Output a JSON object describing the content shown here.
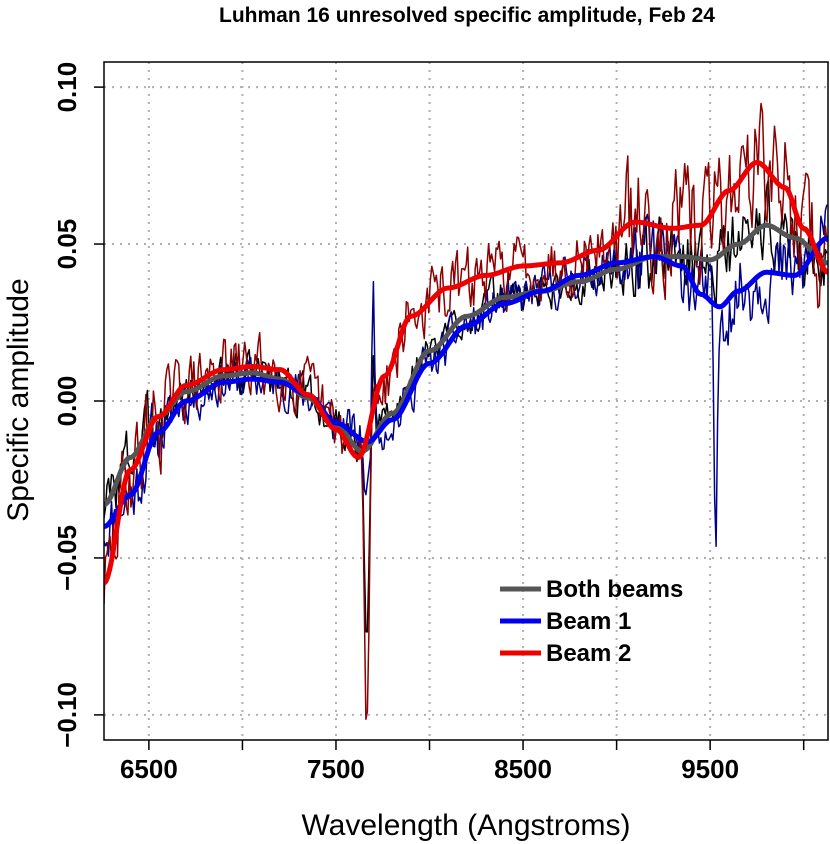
{
  "chart_data": {
    "type": "line",
    "title": "Luhman 16 unresolved specific amplitude, Feb 24",
    "xlabel": "Wavelength (Angstroms)",
    "ylabel": "Specific amplitude",
    "xlim": [
      6260,
      10130
    ],
    "ylim": [
      -0.108,
      0.108
    ],
    "x_ticks": [
      6500,
      7000,
      7500,
      8000,
      8500,
      9000,
      9500,
      10000
    ],
    "x_tick_labels": [
      "6500",
      "",
      "7500",
      "",
      "8500",
      "",
      "9500",
      ""
    ],
    "y_ticks": [
      -0.1,
      -0.05,
      0.0,
      0.05,
      0.1
    ],
    "y_tick_labels": [
      "−0.10",
      "−0.05",
      "0.00",
      "0.05",
      "0.10"
    ],
    "grid": true,
    "legend_position": "bottom-right",
    "smooth_series": [
      {
        "name": "Both beams",
        "color": "#555555",
        "x": [
          6260,
          6400,
          6550,
          6700,
          6900,
          7050,
          7200,
          7350,
          7500,
          7640,
          7800,
          8000,
          8200,
          8400,
          8600,
          8800,
          9000,
          9200,
          9350,
          9500,
          9650,
          9800,
          9950,
          10130
        ],
        "y": [
          -0.033,
          -0.018,
          -0.005,
          0.003,
          0.008,
          0.009,
          0.007,
          0.001,
          -0.008,
          -0.016,
          -0.004,
          0.016,
          0.027,
          0.033,
          0.035,
          0.038,
          0.042,
          0.046,
          0.046,
          0.045,
          0.05,
          0.056,
          0.052,
          0.044
        ]
      },
      {
        "name": "Beam 1",
        "color": "#0000ee",
        "x": [
          6260,
          6400,
          6550,
          6700,
          6900,
          7050,
          7200,
          7350,
          7500,
          7670,
          7800,
          8000,
          8200,
          8400,
          8600,
          8800,
          9000,
          9200,
          9350,
          9450,
          9550,
          9650,
          9800,
          9950,
          10130
        ],
        "y": [
          -0.04,
          -0.03,
          -0.01,
          0.0,
          0.006,
          0.007,
          0.006,
          0.002,
          -0.007,
          -0.013,
          -0.006,
          0.012,
          0.024,
          0.031,
          0.035,
          0.04,
          0.044,
          0.046,
          0.043,
          0.034,
          0.03,
          0.035,
          0.041,
          0.04,
          0.052
        ]
      },
      {
        "name": "Beam 2",
        "color": "#ee0000",
        "x": [
          6260,
          6400,
          6550,
          6700,
          6900,
          7050,
          7200,
          7350,
          7500,
          7620,
          7760,
          7900,
          8100,
          8300,
          8500,
          8700,
          8900,
          9100,
          9300,
          9450,
          9600,
          9750,
          9900,
          10000,
          10130
        ],
        "y": [
          -0.058,
          -0.022,
          -0.005,
          0.005,
          0.01,
          0.011,
          0.01,
          0.002,
          -0.009,
          -0.018,
          0.008,
          0.027,
          0.036,
          0.04,
          0.043,
          0.044,
          0.048,
          0.057,
          0.055,
          0.056,
          0.067,
          0.076,
          0.068,
          0.055,
          0.041
        ]
      }
    ],
    "noisy_series": [
      {
        "color": "#000000",
        "width": 1.5,
        "smooth_index": 0,
        "amplitude": 0.01,
        "seed": 3
      },
      {
        "color": "#00008b",
        "width": 1.5,
        "smooth_index": 1,
        "amplitude": 0.011,
        "seed": 11
      },
      {
        "color": "#8b0000",
        "width": 1.5,
        "smooth_index": 2,
        "amplitude": 0.016,
        "seed": 29
      }
    ],
    "features": [
      {
        "wl": 7665,
        "depth": [
          -0.062,
          -0.018,
          -0.09
        ],
        "width": 18
      },
      {
        "wl": 7700,
        "depth": [
          0.02,
          0.055,
          0.01
        ],
        "width": 10
      },
      {
        "wl": 9530,
        "depth": [
          0.0,
          -0.075,
          0.0
        ],
        "width": 14
      }
    ]
  }
}
